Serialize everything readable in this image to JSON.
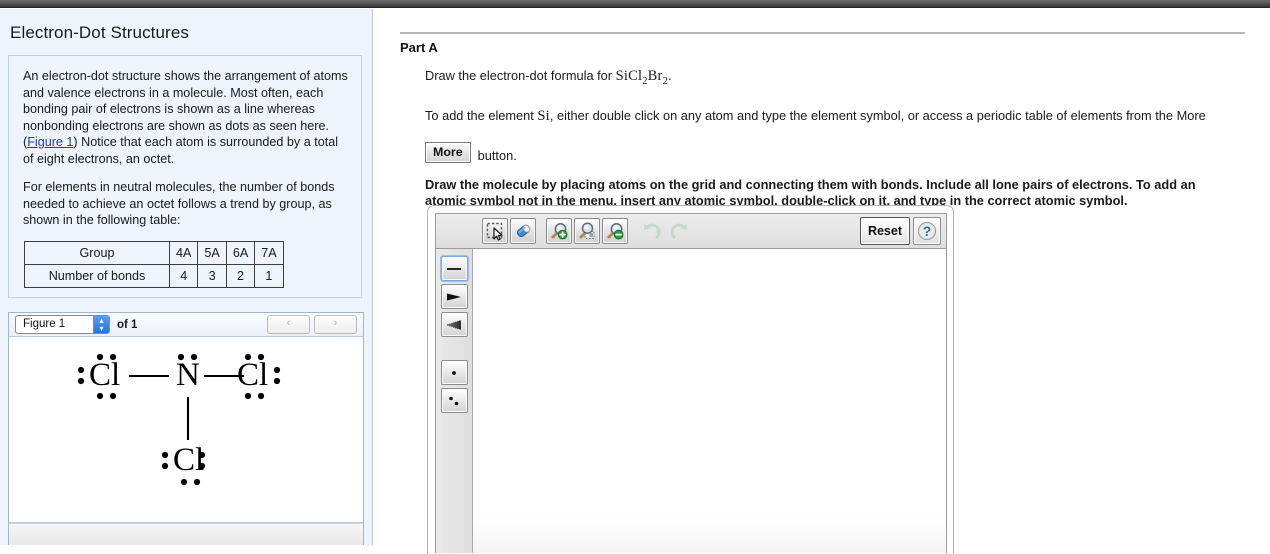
{
  "left_panel": {
    "title": "Electron-Dot Structures",
    "paragraph_1_part_a": "An electron-dot structure shows the arrangement of atoms and valence electrons in a molecule. Most often, each bonding pair of electrons is shown as a line whereas nonbonding electrons are shown as dots as seen here. (",
    "figure_link": "Figure 1",
    "paragraph_1_part_b": ") Notice that each atom is surrounded by a total of eight electrons, an octet.",
    "paragraph_2": "For elements in neutral molecules, the number of bonds needed to achieve an octet follows a trend by group, as shown in the following table:",
    "table": {
      "row_labels": [
        "Group",
        "Number of bonds"
      ],
      "groups": [
        "4A",
        "5A",
        "6A",
        "7A"
      ],
      "bonds": [
        "4",
        "3",
        "2",
        "1"
      ]
    },
    "figure_viewer": {
      "selected_figure": "Figure 1",
      "of_text": "of 1",
      "prev_label": "‹",
      "next_label": "›",
      "stepper_up": "▴",
      "stepper_down": "▾",
      "molecule": {
        "center_atom": "N",
        "terminal_atoms": [
          "Cl",
          "Cl",
          "Cl"
        ],
        "description": "NCl3 electron-dot structure"
      }
    }
  },
  "right_panel": {
    "part_title": "Part A",
    "prompt_prefix": "Draw the electron-dot formula for ",
    "formula": {
      "text": "SiCl2Br2",
      "segments": [
        {
          "t": "SiCl",
          "sub": false
        },
        {
          "t": "2",
          "sub": true
        },
        {
          "t": "Br",
          "sub": false
        },
        {
          "t": "2",
          "sub": true
        }
      ],
      "trailing": "."
    },
    "instruction_prefix": "To add the element ",
    "instruction_element": "Si",
    "instruction_suffix": ", either double click on any atom and type the element symbol, or access a periodic table of elements from the More",
    "more_button_label": "More",
    "more_suffix": "button.",
    "bold_instruction_line_1": "Draw the molecule by placing atoms on the grid and connecting them with bonds. Include all lone pairs of electrons. To add an",
    "bold_instruction_line_2": "atomic symbol not in the menu, insert any atomic symbol, double-click on it, and type in the correct atomic symbol.",
    "drawing_tool": {
      "top_tools": [
        {
          "name": "select-tool",
          "icon": "select-marquee-icon",
          "enabled": true
        },
        {
          "name": "eraser-tool",
          "icon": "eraser-icon",
          "enabled": true
        },
        {
          "name": "zoom-in-tool",
          "icon": "magnifier-plus-icon",
          "enabled": true
        },
        {
          "name": "zoom-fit-tool",
          "icon": "magnifier-fit-icon",
          "enabled": true
        },
        {
          "name": "zoom-out-tool",
          "icon": "magnifier-minus-icon",
          "enabled": true
        },
        {
          "name": "undo-tool",
          "icon": "undo-arrow-icon",
          "enabled": false
        },
        {
          "name": "redo-tool",
          "icon": "redo-arrow-icon",
          "enabled": false
        }
      ],
      "reset_label": "Reset",
      "help_label": "?",
      "side_tools": [
        {
          "name": "single-bond-tool",
          "icon": "single-bond-icon",
          "active": true
        },
        {
          "name": "wedge-bond-tool",
          "icon": "wedge-bond-icon",
          "active": false
        },
        {
          "name": "hash-bond-tool",
          "icon": "hash-bond-icon",
          "active": false
        },
        {
          "name": "single-electron-tool",
          "icon": "single-dot-icon",
          "active": false
        },
        {
          "name": "lone-pair-tool",
          "icon": "two-dots-icon",
          "active": false
        }
      ]
    }
  },
  "colors": {
    "panel_bg": "#eef4fc",
    "panel_border": "#c2d2e4",
    "link": "#19439c",
    "topbar": "#4a4a4a",
    "accent_blue": "#2a72d8"
  }
}
